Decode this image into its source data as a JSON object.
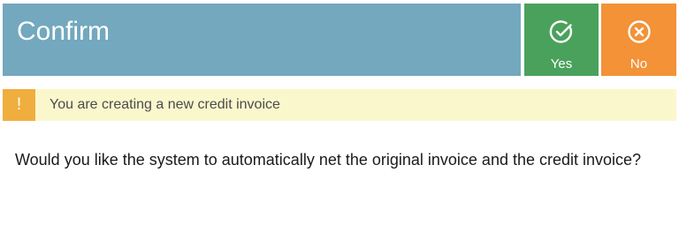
{
  "dialog": {
    "title": "Confirm",
    "actions": {
      "yes": {
        "label": "Yes",
        "icon": "check-circle-icon",
        "color": "#4aa15c"
      },
      "no": {
        "label": "No",
        "icon": "x-circle-icon",
        "color": "#f39237"
      }
    },
    "header_color": "#73a8be",
    "warning": {
      "icon": "!",
      "text": "You are creating a new credit invoice",
      "badge_color": "#f0ae3e",
      "background": "#fbf7cd"
    },
    "question": "Would you like the system to automatically net the original invoice and the credit invoice?"
  }
}
